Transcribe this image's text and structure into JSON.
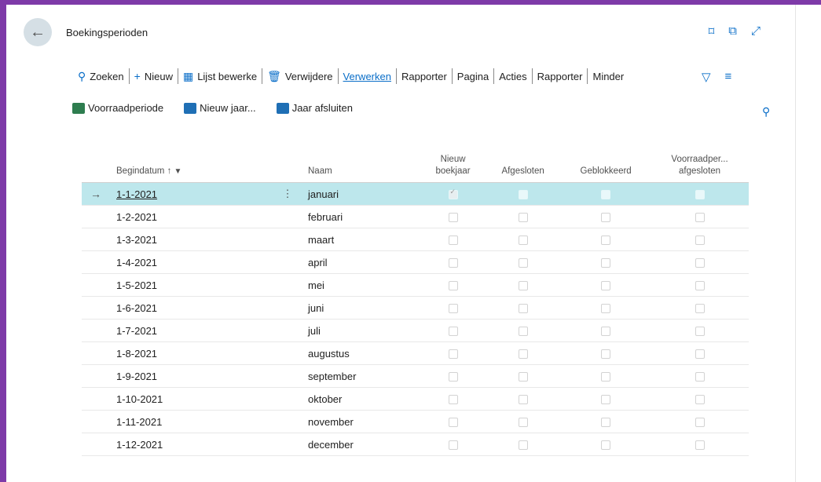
{
  "header": {
    "title": "Boekingsperioden"
  },
  "actions": [
    {
      "icon": "search-icon",
      "label": "Zoeken"
    },
    {
      "icon": "plus-icon",
      "label": "Nieuw"
    },
    {
      "icon": "edit-list-icon",
      "label": "Lijst bewerke"
    },
    {
      "icon": "delete-icon",
      "label": "Verwijdere"
    },
    {
      "label": "Verwerken"
    },
    {
      "label": "Rapporter"
    },
    {
      "label": "Pagina"
    },
    {
      "label": "Acties"
    },
    {
      "label": "Rapporter"
    },
    {
      "label": "Minder"
    }
  ],
  "promoted": [
    {
      "label": "Voorraadperiode",
      "color": "#2e7d4f"
    },
    {
      "label": "Nieuw jaar...",
      "color": "#1f6fb5"
    },
    {
      "label": "Jaar afsluiten",
      "color": "#1f6fb5"
    }
  ],
  "columns": {
    "begindatum": "Begindatum ↑",
    "naam": "Naam",
    "nieuw_line1": "Nieuw",
    "nieuw_line2": "boekjaar",
    "afgesloten": "Afgesloten",
    "geblokkeerd": "Geblokkeerd",
    "voorraad_line1": "Voorraadper...",
    "voorraad_line2": "afgesloten"
  },
  "rows": [
    {
      "date": "1-1-2021",
      "name": "januari"
    },
    {
      "date": "1-2-2021",
      "name": "februari"
    },
    {
      "date": "1-3-2021",
      "name": "maart"
    },
    {
      "date": "1-4-2021",
      "name": "april"
    },
    {
      "date": "1-5-2021",
      "name": "mei"
    },
    {
      "date": "1-6-2021",
      "name": "juni"
    },
    {
      "date": "1-7-2021",
      "name": "juli"
    },
    {
      "date": "1-8-2021",
      "name": "augustus"
    },
    {
      "date": "1-9-2021",
      "name": "september"
    },
    {
      "date": "1-10-2021",
      "name": "oktober"
    },
    {
      "date": "1-11-2021",
      "name": "november"
    },
    {
      "date": "1-12-2021",
      "name": "december"
    }
  ],
  "colors": {
    "frame": "#7e3aa8",
    "accent": "#0a6ec8",
    "selected_row": "#bde7ec"
  }
}
